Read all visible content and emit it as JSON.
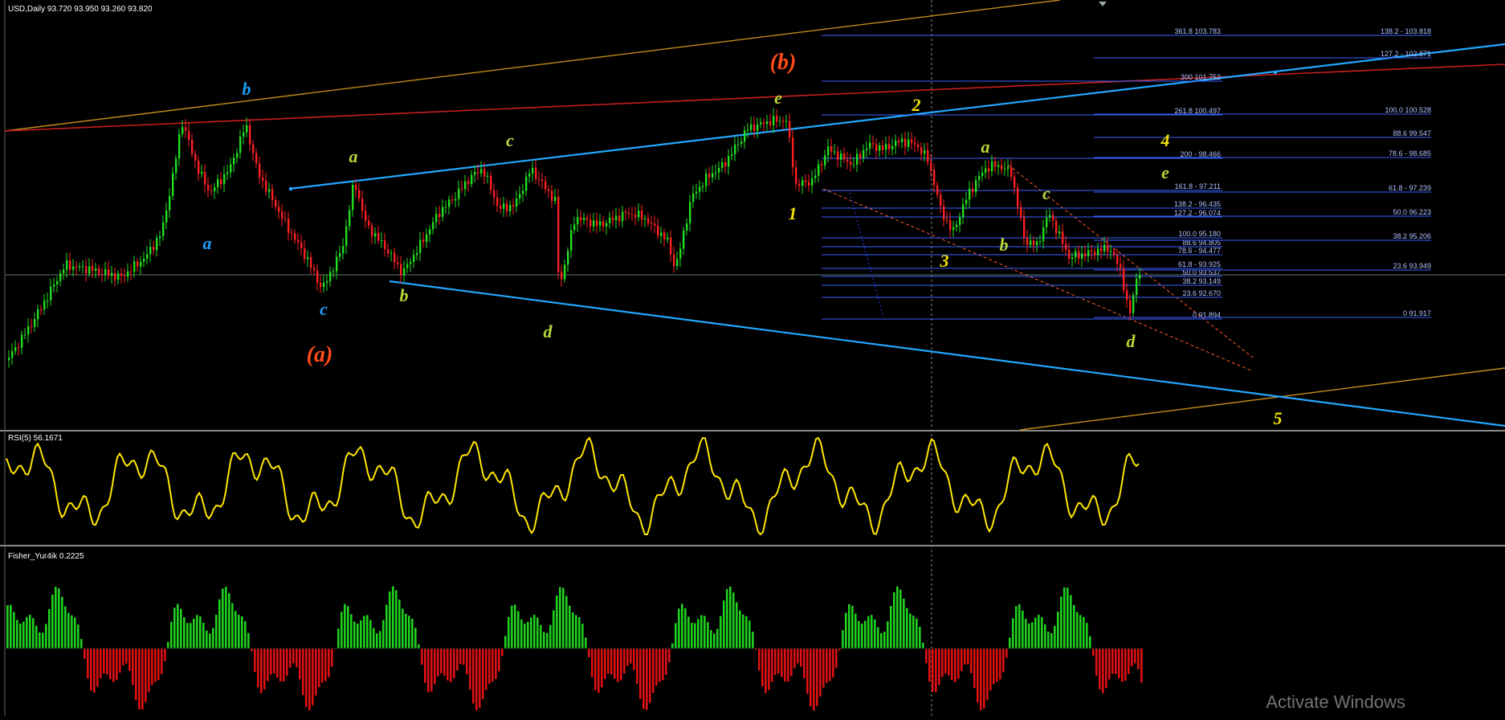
{
  "main_panel": {
    "symbol_line": "USD,Daily  93.720 93.950 93.260 93.820",
    "wave_labels": [
      {
        "text": "a",
        "color": "#1ea0ff",
        "size": 22
      },
      {
        "text": "b",
        "color": "#1ea0ff",
        "size": 22
      },
      {
        "text": "c",
        "color": "#1ea0ff",
        "size": 22
      },
      {
        "text": "a",
        "color": "#b8d83a",
        "size": 22
      },
      {
        "text": "b",
        "color": "#b8d83a",
        "size": 22
      },
      {
        "text": "c",
        "color": "#b8d83a",
        "size": 22
      },
      {
        "text": "d",
        "color": "#b8d83a",
        "size": 22
      },
      {
        "text": "e",
        "color": "#b8d83a",
        "size": 22
      },
      {
        "text": "(a)",
        "color": "#ff4a1a",
        "size": 28
      },
      {
        "text": "(b)",
        "color": "#ff4a1a",
        "size": 28
      },
      {
        "text": "1",
        "color": "#f0e000",
        "size": 22
      },
      {
        "text": "2",
        "color": "#f0e000",
        "size": 22
      },
      {
        "text": "3",
        "color": "#f0e000",
        "size": 22
      },
      {
        "text": "4",
        "color": "#f0e000",
        "size": 22
      },
      {
        "text": "5",
        "color": "#f0e000",
        "size": 22
      },
      {
        "text": "a",
        "color": "#b8d83a",
        "size": 22
      },
      {
        "text": "b",
        "color": "#b8d83a",
        "size": 22
      },
      {
        "text": "c",
        "color": "#b8d83a",
        "size": 22
      },
      {
        "text": "d",
        "color": "#b8d83a",
        "size": 22
      },
      {
        "text": "e",
        "color": "#b8d83a",
        "size": 22
      }
    ],
    "fib_left": [
      "361.8 103.783",
      "300 101.752",
      "261.8 100.497",
      "200 - 98.466",
      "161.8 - 97.211",
      "138.2 - 96.435",
      "127.2 - 96.074",
      "100.0 95.180",
      "88.6 94.805",
      "78.6 - 94.477",
      "61.8 - 93.925",
      "50.0 93.537",
      "38.2 93.149",
      "23.6 92.670",
      "0 91.894"
    ],
    "fib_right": [
      "138.2 - 103.818",
      "127.2 - 102.871",
      "100.0 100.528",
      "88.6 99.547",
      "78.6 - 98.685",
      "61.8 - 97.239",
      "50.0 96.223",
      "38.2 95.206",
      "23.6 93.949",
      "0 91.917"
    ]
  },
  "rsi_panel": {
    "title": "RSI(5) 56.1671"
  },
  "fisher_panel": {
    "title": "Fisher_Yur4ik 0.2225"
  },
  "watermark": {
    "text": "Activate Windows"
  },
  "colors": {
    "background": "#000000",
    "bull_candle": "#22e022",
    "bear_candle": "#ff2020",
    "rsi_line": "#ffe600",
    "fisher_up": "#1fd11f",
    "fisher_down": "#e01010",
    "fib_line": "#3a62ff",
    "channel_blue": "#22a8ff",
    "trend_red": "#c81e1e",
    "trend_orange": "#c58a1a"
  }
}
